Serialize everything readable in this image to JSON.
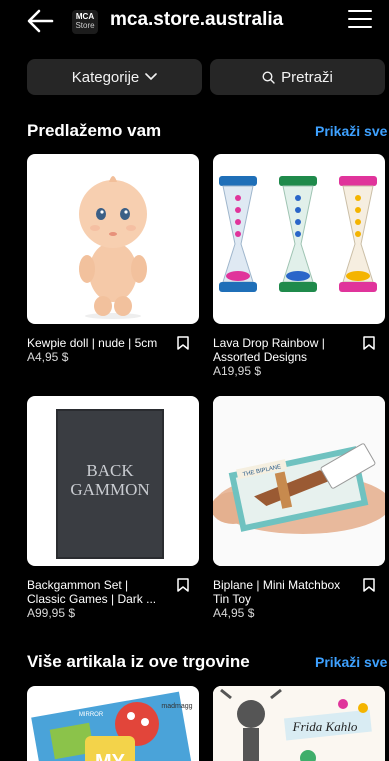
{
  "header": {
    "logo_line1": "MCA",
    "logo_line2": "Store",
    "store_name": "mca.store.australia"
  },
  "filters": {
    "category_label": "Kategorije",
    "search_label": "Pretraži"
  },
  "sections": {
    "suggested": {
      "title": "Predlažemo vam",
      "see_all": "Prikaži sve"
    },
    "more": {
      "title": "Više artikala iz ove trgovine",
      "see_all": "Prikaži sve"
    }
  },
  "products": [
    {
      "title": "Kewpie doll | nude | 5cm",
      "price": "A4,95 $"
    },
    {
      "title": "Lava Drop Rainbow | Assorted Designs",
      "price": "A19,95 $"
    },
    {
      "title": "Backgammon Set | Classic Games | Dark ...",
      "price": "A99,95 $"
    },
    {
      "title": "Biplane | Mini Matchbox Tin Toy",
      "price": "A4,95 $"
    }
  ],
  "image_text": {
    "backgammon_1": "BACK",
    "backgammon_2": "GAMMON",
    "biplane_box": "THE BIPLANE",
    "book_my": "MY",
    "book_brand": "madmagg",
    "book_mirror": "MIRROR",
    "frida": "Frida Kahlo"
  },
  "colors": {
    "accent": "#3ea1ff",
    "background": "#000000",
    "pill": "#262626"
  }
}
